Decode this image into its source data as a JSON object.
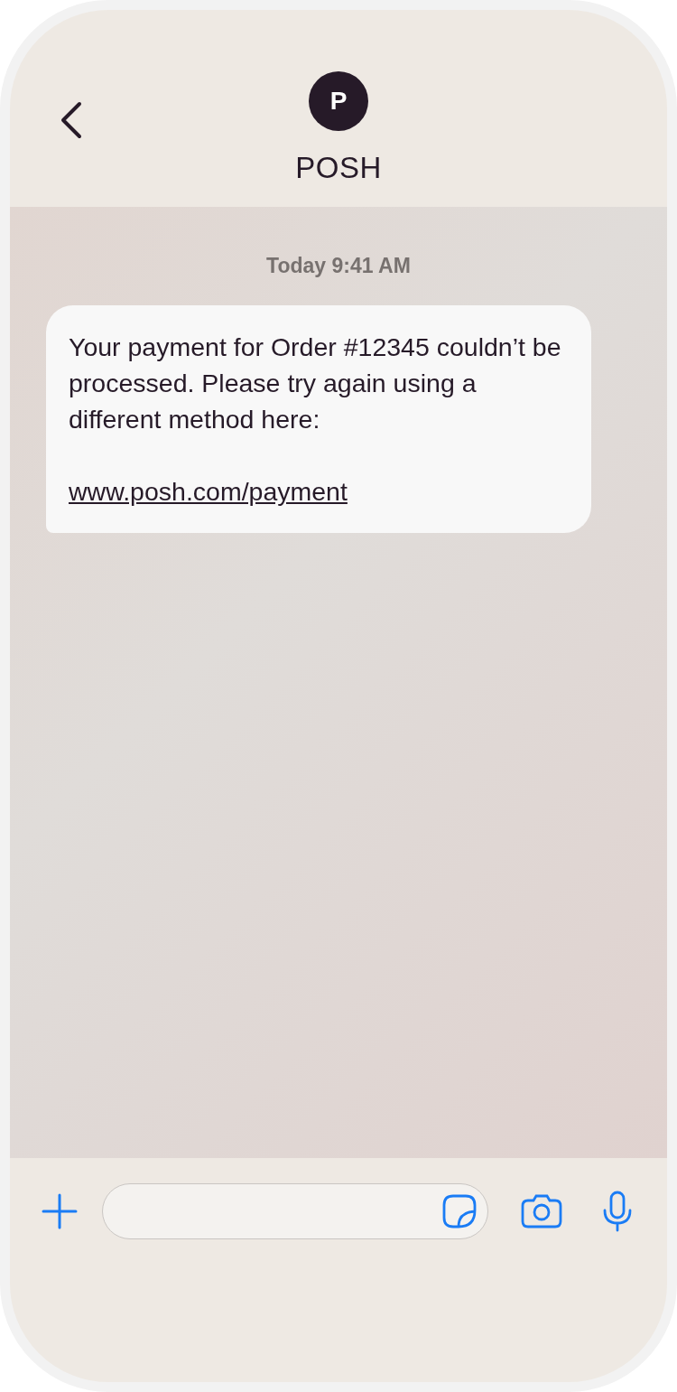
{
  "contact": {
    "initial": "P",
    "name": "POSH"
  },
  "timestamp": "Today 9:41 AM",
  "messages": [
    {
      "text": "Your payment for Order #12345 couldn’t be processed. Please try again using a different method here:",
      "link": "www.posh.com/payment"
    }
  ]
}
